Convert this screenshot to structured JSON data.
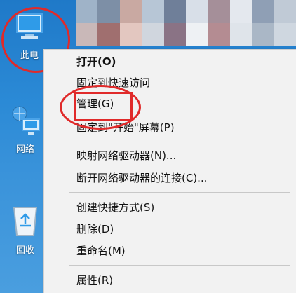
{
  "desktop": {
    "icons": [
      {
        "name": "this-pc",
        "label": "此电"
      },
      {
        "name": "network",
        "label": "网络"
      },
      {
        "name": "recycle-bin",
        "label": "回收"
      }
    ]
  },
  "context_menu": {
    "items": [
      {
        "label": "打开(O)",
        "bold": true
      },
      {
        "label": "固定到快速访问"
      },
      {
        "label": "管理(G)"
      },
      {
        "label": "固定到\"开始\"屏幕(P)"
      },
      {
        "label": "映射网络驱动器(N)..."
      },
      {
        "label": "断开网络驱动器的连接(C)..."
      },
      {
        "label": "创建快捷方式(S)"
      },
      {
        "label": "删除(D)"
      },
      {
        "label": "重命名(M)"
      },
      {
        "label": "属性(R)"
      }
    ]
  },
  "colors": {
    "annotation_red": "#e02a2a",
    "menu_bg": "#f2f2f2"
  }
}
